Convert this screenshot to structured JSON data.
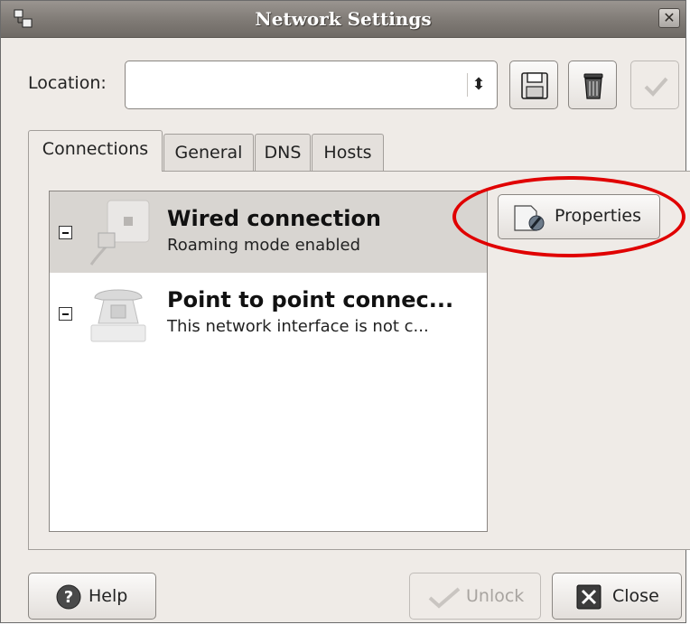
{
  "window": {
    "title": "Network Settings"
  },
  "location": {
    "label": "Location:",
    "value": ""
  },
  "tabs": [
    "Connections",
    "General",
    "DNS",
    "Hosts"
  ],
  "connections": [
    {
      "title": "Wired connection",
      "subtitle": "Roaming mode enabled",
      "selected": true
    },
    {
      "title": "Point to point connec...",
      "subtitle": "This network interface is not c...",
      "selected": false
    }
  ],
  "buttons": {
    "properties": "Properties",
    "help": "Help",
    "unlock": "Unlock",
    "close": "Close"
  },
  "icons": {
    "app": "network-settings-icon",
    "save": "floppy-disk-icon",
    "delete": "trash-can-icon",
    "apply": "checkmark-icon",
    "properties": "properties-wrench-icon",
    "help": "help-question-icon",
    "unlock": "checkmark-icon",
    "close": "close-x-icon"
  },
  "colors": {
    "annotation_ring": "#e00000",
    "titlebar": "#807b76"
  }
}
